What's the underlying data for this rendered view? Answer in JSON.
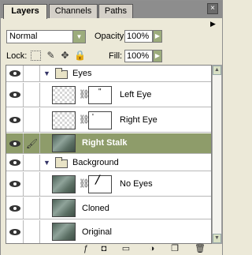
{
  "tabs": [
    {
      "label": "Layers"
    },
    {
      "label": "Channels"
    },
    {
      "label": "Paths"
    }
  ],
  "controls": {
    "blend_mode": "Normal",
    "opacity_label": "Opacity:",
    "opacity_value": "100%",
    "lock_label": "Lock:",
    "fill_label": "Fill:",
    "fill_value": "100%"
  },
  "layers": [
    {
      "name": "Eyes",
      "kind": "group"
    },
    {
      "name": "Left Eye",
      "kind": "masked"
    },
    {
      "name": "Right Eye",
      "kind": "masked"
    },
    {
      "name": "Right Stalk",
      "kind": "image",
      "selected": true
    },
    {
      "name": "Background",
      "kind": "group"
    },
    {
      "name": "No Eyes",
      "kind": "masked"
    },
    {
      "name": "Cloned",
      "kind": "image"
    },
    {
      "name": "Original",
      "kind": "image"
    }
  ],
  "colors": {
    "selected_row": "#8e9c6a",
    "panel_bg": "#ece9d8",
    "tab_bar": "#8d8d8d"
  },
  "icons": [
    "close-icon",
    "panel-menu-icon",
    "lock-transparent-icon",
    "lock-paint-icon",
    "lock-move-icon",
    "lock-all-icon",
    "eye-icon",
    "brush-icon",
    "link-icon",
    "folder-icon",
    "expand-triangle-icon",
    "layer-style-icon",
    "add-mask-icon",
    "new-group-icon",
    "adjustment-layer-icon",
    "new-layer-icon",
    "trash-icon"
  ]
}
